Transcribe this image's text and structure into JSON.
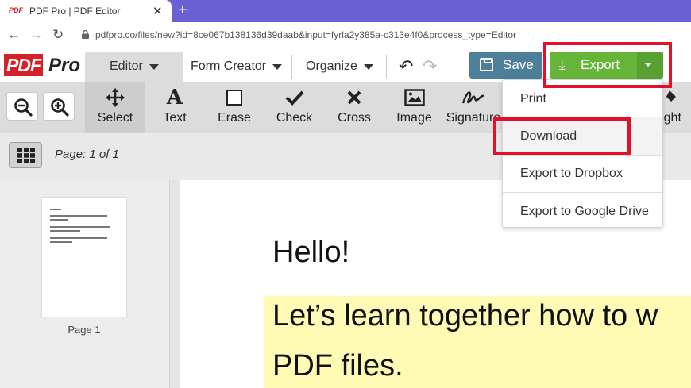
{
  "browser": {
    "tab_favicon": "PDF",
    "tab_title": "PDF Pro | PDF Editor",
    "tab_close": "✕",
    "new_tab": "+",
    "url": "pdfpro.co/files/new?id=8ce067b138136d39daab&input=fyrla2y385a-c313e4f0&process_type=Editor"
  },
  "logo": {
    "pdf": "PDF",
    "pro": "Pro"
  },
  "menu": {
    "editor": "Editor",
    "form_creator": "Form Creator",
    "organize": "Organize"
  },
  "actions": {
    "save": "Save",
    "export": "Export"
  },
  "tools": [
    {
      "label": "Select",
      "icon": "move-icon"
    },
    {
      "label": "Text",
      "icon": "text-icon"
    },
    {
      "label": "Erase",
      "icon": "erase-icon"
    },
    {
      "label": "Check",
      "icon": "check-icon"
    },
    {
      "label": "Cross",
      "icon": "cross-icon"
    },
    {
      "label": "Image",
      "icon": "image-icon"
    },
    {
      "label": "Signature",
      "icon": "signature-icon"
    },
    {
      "label": "ight",
      "icon": "highlight-icon"
    }
  ],
  "pagebar": {
    "indicator": "Page: 1 of 1"
  },
  "sidebar": {
    "thumb_label": "Page 1"
  },
  "document": {
    "hello": "Hello!",
    "line1": "Let’s learn together how to w",
    "line2": "PDF files."
  },
  "export_menu": {
    "items": [
      "Print",
      "Download",
      "Export to Dropbox",
      "Export to Google Drive"
    ]
  },
  "colors": {
    "tabbar": "#6b5fd3",
    "save": "#4d7f9b",
    "export": "#66b43a",
    "highlight_box": "#e3102a",
    "doc_highlight": "#fffbb5"
  }
}
